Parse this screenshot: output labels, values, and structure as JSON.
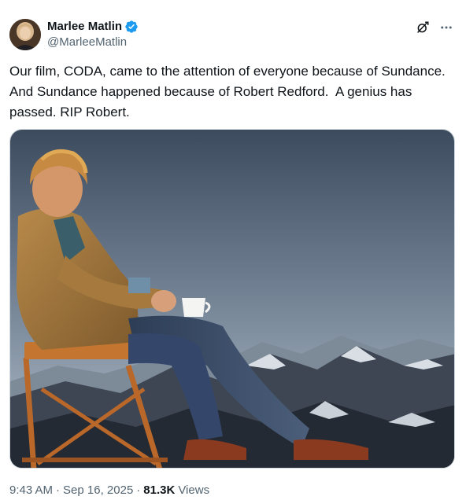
{
  "author": {
    "display_name": "Marlee Matlin",
    "handle": "@MarleeMatlin",
    "verified": true,
    "verified_color": "#1d9bf0"
  },
  "post": {
    "text": "Our film, CODA, came to the attention of everyone because of Sundance. And Sundance happened because of Robert Redford.  A genius has passed. RIP Robert.",
    "time": "9:43 AM",
    "separator": "·",
    "date": "Sep 16, 2025",
    "views_count": "81.3K",
    "views_label": "Views"
  },
  "icons": {
    "grok": "grok-icon",
    "more": "more-dots-icon",
    "verified": "verified-badge-icon"
  },
  "colors": {
    "text_primary": "#0f1419",
    "text_secondary": "#536471",
    "border": "#cfd9de"
  }
}
